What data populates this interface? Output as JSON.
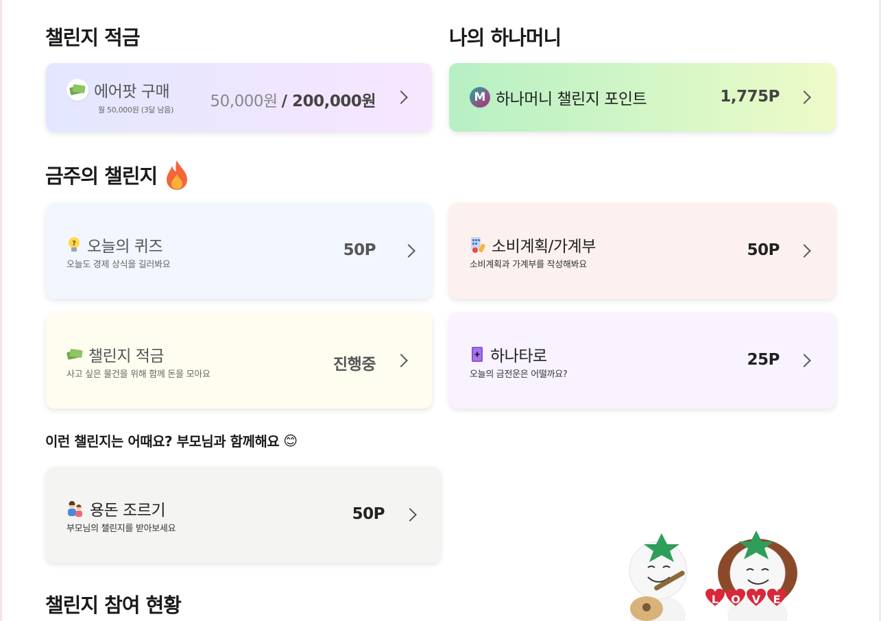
{
  "savings_section": {
    "title": "챌린지 적금"
  },
  "hana_money_section": {
    "title": "나의 하나머니"
  },
  "savings_card": {
    "title": "에어팟 구매",
    "desc": "월 50,000원 (3달 남음)",
    "current": "50,000원",
    "target": "/ 200,000원",
    "icon": "money-icon",
    "gradient": [
      "#e2e7ff",
      "#f8e6ff"
    ]
  },
  "hana_money_card": {
    "title": "하나머니 챌린지 포인트",
    "value": "1,775P",
    "icon_letter": "M",
    "gradient": [
      "#b6f0c4",
      "#eefbc8"
    ]
  },
  "weekly_section": {
    "title": "금주의 챌린지",
    "icon": "fire-icon"
  },
  "weekly_cards": [
    {
      "title": "오늘의 퀴즈",
      "desc": "오늘도 경제 상식을 길러봐요",
      "value": "50P",
      "icon": "lightbulb-icon",
      "bg": "#f2f6fe"
    },
    {
      "title": "소비계획/가계부",
      "desc": "소비계획과 가계부를 작성해봐요",
      "value": "50P",
      "icon": "calculator-icon",
      "bg": "#fdf1ef"
    },
    {
      "title": "챌린지 적금",
      "desc": "사고 싶은 물건을 위해 함께 돈을 모아요",
      "value": "진행중",
      "icon": "money-icon",
      "bg": "#fffdf0"
    },
    {
      "title": "하나타로",
      "desc": "오늘의 금전운은 어떨까요?",
      "value": "25P",
      "icon": "tarot-card-icon",
      "bg": "#f8f3fe"
    }
  ],
  "parent_section": {
    "title": "이런 챌린지는 어때요? 부모님과 함께해요",
    "emoji": "😊"
  },
  "parent_card": {
    "title": "용돈 조르기",
    "desc": "부모님의 챌린지를 받아보세요",
    "value": "50P",
    "icon": "parent-child-icon",
    "bg": "#f4f4f2"
  },
  "status_section": {
    "title": "챌린지 참여 현황"
  },
  "mascot": {
    "love_letters": [
      "L",
      "O",
      "V",
      "E"
    ]
  }
}
